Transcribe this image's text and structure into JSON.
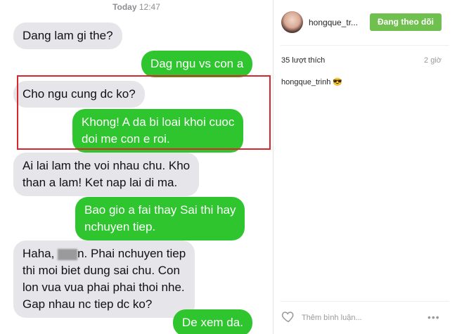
{
  "chat": {
    "timestamp_day": "Today",
    "timestamp_time": "12:47",
    "messages": [
      {
        "side": "recv",
        "lines": [
          "Dang lam gi the?"
        ]
      },
      {
        "side": "sent",
        "lines": [
          "Dag ngu vs con a"
        ]
      },
      {
        "side": "recv",
        "lines": [
          "Cho ngu cung dc ko?"
        ]
      },
      {
        "side": "sent",
        "lines": [
          "Khong! A da bi loai khoi cuoc",
          "doi me con e roi."
        ]
      },
      {
        "side": "recv",
        "lines": [
          "Ai lai lam the voi nhau chu. Kho",
          "than a lam! Ket nap lai di ma."
        ]
      },
      {
        "side": "sent",
        "lines": [
          "Bao gio a fai thay Sai thi hay",
          "nchuyen tiep."
        ]
      },
      {
        "side": "recv",
        "lines_pre": "Haha, ",
        "lines_post": "n. Phai nchuyen tiep",
        "lines": [
          "thi moi biet dung sai chu. Con",
          "lon vua vua phai phai thoi nhe.",
          "Gap nhau nc tiep dc ko?"
        ]
      },
      {
        "side": "sent",
        "lines": [
          "De xem da."
        ]
      }
    ]
  },
  "post": {
    "username": "hongque_tr...",
    "follow_label": "Đang theo dõi",
    "likes": "35 lượt thích",
    "time_ago": "2 giờ",
    "caption": "hongque_trinh 😎",
    "comment_placeholder": "Thêm bình luận...",
    "more_label": "•••",
    "colors": {
      "follow": "#70c050",
      "sent_bubble": "#2ec52e",
      "recv_bubble": "#e5e5ea",
      "highlight": "#d9252b"
    },
    "icons": [
      "heart-icon",
      "more-options-icon"
    ]
  }
}
